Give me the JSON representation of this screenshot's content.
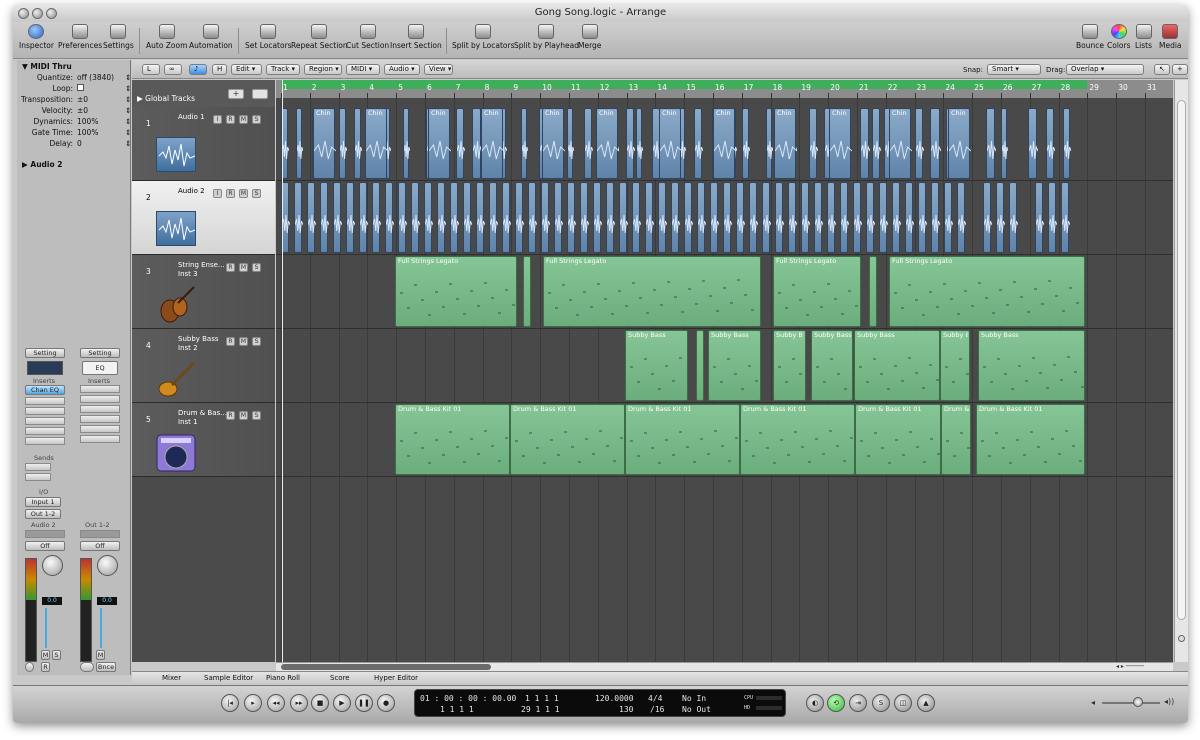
{
  "window": {
    "title": "Gong Song.logic - Arrange"
  },
  "toolbar": {
    "items": [
      "Inspector",
      "Preferences",
      "Settings",
      "Auto Zoom",
      "Automation",
      "Set Locators",
      "Repeat Section",
      "Cut Section",
      "Insert Section",
      "Split by Locators",
      "Split by Playhead",
      "Merge",
      "Bounce",
      "Colors",
      "Lists",
      "Media"
    ]
  },
  "inspector": {
    "region_header": "MIDI Thru",
    "params": [
      {
        "label": "Quantize:",
        "value": "off (3840)"
      },
      {
        "label": "Loop:",
        "value": ""
      },
      {
        "label": "Transposition:",
        "value": "±0"
      },
      {
        "label": "Velocity:",
        "value": "±0"
      },
      {
        "label": "Dynamics:",
        "value": "100%"
      },
      {
        "label": "Gate Time:",
        "value": "100%"
      },
      {
        "label": "Delay:",
        "value": "0"
      }
    ],
    "track_header": "Audio 2",
    "strip1": {
      "setting": "Setting",
      "inserts": "Inserts",
      "insert1": "Chan EQ",
      "sends": "Sends",
      "io": "I/O",
      "input": "Input 1",
      "output": "Out 1-2",
      "name": "Audio 2",
      "automation": "Off",
      "volume": "0.0",
      "m": "M",
      "s": "S",
      "r": "R"
    },
    "strip2": {
      "setting": "Setting",
      "eq": "EQ",
      "inserts": "Inserts",
      "name": "Out 1-2",
      "automation": "Off",
      "volume": "0.0",
      "m": "M",
      "bounce": "Bnce"
    }
  },
  "localbar": {
    "menus": [
      "Edit",
      "Track",
      "Region",
      "MIDI",
      "Audio",
      "View"
    ],
    "snap_label": "Snap:",
    "snap_value": "Smart",
    "drag_label": "Drag:",
    "drag_value": "Overlap"
  },
  "tracklist": {
    "global_tracks": "Global Tracks",
    "tracks": [
      {
        "num": "1",
        "name": "Audio 1",
        "sub": "",
        "buttons": [
          "I",
          "R",
          "M",
          "S"
        ]
      },
      {
        "num": "2",
        "name": "Audio 2",
        "sub": "",
        "buttons": [
          "I",
          "R",
          "M",
          "S"
        ]
      },
      {
        "num": "3",
        "name": "String Ense...",
        "sub": "Inst 3",
        "buttons": [
          "R",
          "M",
          "S"
        ]
      },
      {
        "num": "4",
        "name": "Subby Bass",
        "sub": "Inst 2",
        "buttons": [
          "R",
          "M",
          "S"
        ]
      },
      {
        "num": "5",
        "name": "Drum & Bas...",
        "sub": "Inst 1",
        "buttons": [
          "R",
          "M",
          "S"
        ]
      }
    ]
  },
  "ruler": {
    "bars": [
      "1",
      "2",
      "3",
      "4",
      "5",
      "6",
      "7",
      "8",
      "9",
      "10",
      "11",
      "12",
      "13",
      "14",
      "15",
      "16",
      "17",
      "18",
      "19",
      "20",
      "21",
      "22",
      "23",
      "24",
      "25",
      "26",
      "27",
      "28",
      "29",
      "30",
      "31"
    ]
  },
  "region_labels": {
    "audio": "Chin",
    "strings": "Full Strings Legato",
    "bass": "Subby Bass",
    "bass_short": "Subby B",
    "bass_tiny": "Subby &",
    "drums": "Drum & Bass Kit 01",
    "drums_short": "Drum &"
  },
  "bottom_tabs": [
    "Mixer",
    "Sample Editor",
    "Piano Roll",
    "Score",
    "Hyper Editor"
  ],
  "transport": {
    "time": "01 : 00 : 00 : 00.00",
    "bars_top": "1  1  1  1",
    "bars_bottom": "1  1  1  1",
    "bars2_top": "1  1  1  1",
    "bars2_bottom": "29  1  1  1",
    "tempo": "120.0000",
    "tempo_bottom": "130",
    "sig": "4/4",
    "div": "/16",
    "midi_in": "No In",
    "midi_out": "No Out",
    "cpu": "CPU",
    "hd": "HD"
  }
}
